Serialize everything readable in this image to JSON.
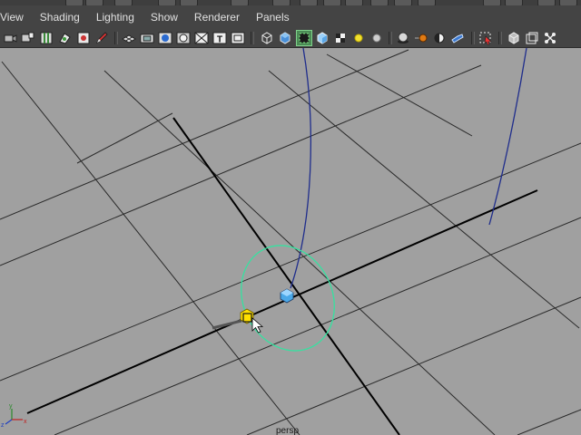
{
  "menubar": {
    "items": [
      {
        "label": "View"
      },
      {
        "label": "Shading"
      },
      {
        "label": "Lighting"
      },
      {
        "label": "Show"
      },
      {
        "label": "Renderer"
      },
      {
        "label": "Panels"
      }
    ]
  },
  "toolbar": {
    "icons": [
      "select-camera-icon",
      "camera-attributes-icon",
      "bookmarks-icon",
      "image-plane-icon",
      "2d-pan-zoom-icon",
      "grease-pencil-icon",
      "grid-icon",
      "film-gate-icon",
      "resolution-gate-icon",
      "gate-mask-icon",
      "field-chart-icon",
      "safe-title-icon",
      "wireframe-icon",
      "smooth-shade-icon",
      "wireframe-on-shaded-icon",
      "xray-icon",
      "textured-icon",
      "use-all-lights-icon",
      "shadows-icon",
      "screen-space-ao-icon",
      "motion-blur-icon",
      "multisample-aa-icon",
      "depth-of-field-icon",
      "isolate-select-icon",
      "xray-joints-icon",
      "xray-active-components-icon",
      "ui-toggle-icon"
    ],
    "active_icon": "wireframe-on-shaded-icon"
  },
  "viewport": {
    "camera_label": "persp",
    "background_color": "#a0a0a0",
    "grid_color": "#2a2a2a",
    "axis_color": "#000000",
    "curve_color": "#1f2d8c",
    "manipulator_color": "#35e2a0",
    "handle_yellow": "#ffe000",
    "handle_blue": "#4aa8e8"
  }
}
